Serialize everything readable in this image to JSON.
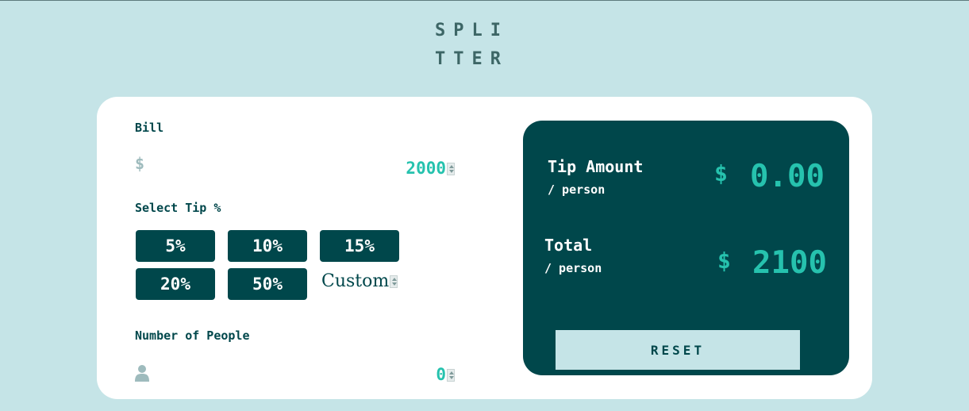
{
  "logo": {
    "line1": "SPLI",
    "line2": "TTER"
  },
  "bill": {
    "label": "Bill",
    "currency_icon": "dollar-icon",
    "value": "2000"
  },
  "tip": {
    "label": "Select Tip %",
    "options": [
      "5%",
      "10%",
      "15%",
      "20%",
      "50%"
    ],
    "custom_value": "Custom"
  },
  "people": {
    "label": "Number of People",
    "icon": "person-icon",
    "value": "0"
  },
  "results": {
    "tip_title": "Tip Amount",
    "tip_sub": "/ person",
    "tip_currency": "$",
    "tip_value": "0.00",
    "total_title": "Total",
    "total_sub": "/ person",
    "total_currency": "$",
    "total_value": "2100",
    "reset_label": "RESET"
  },
  "colors": {
    "background": "#c5e4e7",
    "dark_cyan": "#00474b",
    "accent": "#26c2ae",
    "white": "#ffffff"
  }
}
